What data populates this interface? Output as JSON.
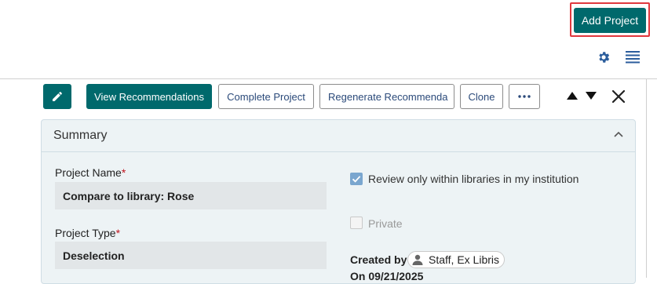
{
  "header": {
    "add_project_label": "Add Project",
    "settings_icon": "gear-icon",
    "list_view_icon": "list-icon"
  },
  "toolbar": {
    "edit_icon": "pencil-icon",
    "view_recommendations_label": "View Recommendations",
    "complete_project_label": "Complete Project",
    "regenerate_label": "Regenerate Recommenda",
    "clone_label": "Clone",
    "more_icon": "ellipsis-icon",
    "prev_icon": "arrow-up-icon",
    "next_icon": "arrow-down-icon",
    "close_icon": "close-icon"
  },
  "summary": {
    "title": "Summary",
    "project_name_label": "Project Name",
    "project_name_value": "Compare to library: Rose",
    "project_type_label": "Project Type",
    "project_type_value": "Deselection",
    "required_mark": "*",
    "review_label": "Review only within libraries in my institution",
    "review_checked": true,
    "private_label": "Private",
    "private_checked": false,
    "created_by_label": "Created by",
    "created_by_value": "Staff, Ex Libris",
    "created_on": "On 09/21/2025"
  },
  "colors": {
    "accent": "#00696c",
    "highlight_border": "#e0383e",
    "panel_bg": "#edf3f5",
    "field_bg": "#e2e6e8",
    "required": "#c0141e",
    "link_text": "#2b4a7a"
  }
}
